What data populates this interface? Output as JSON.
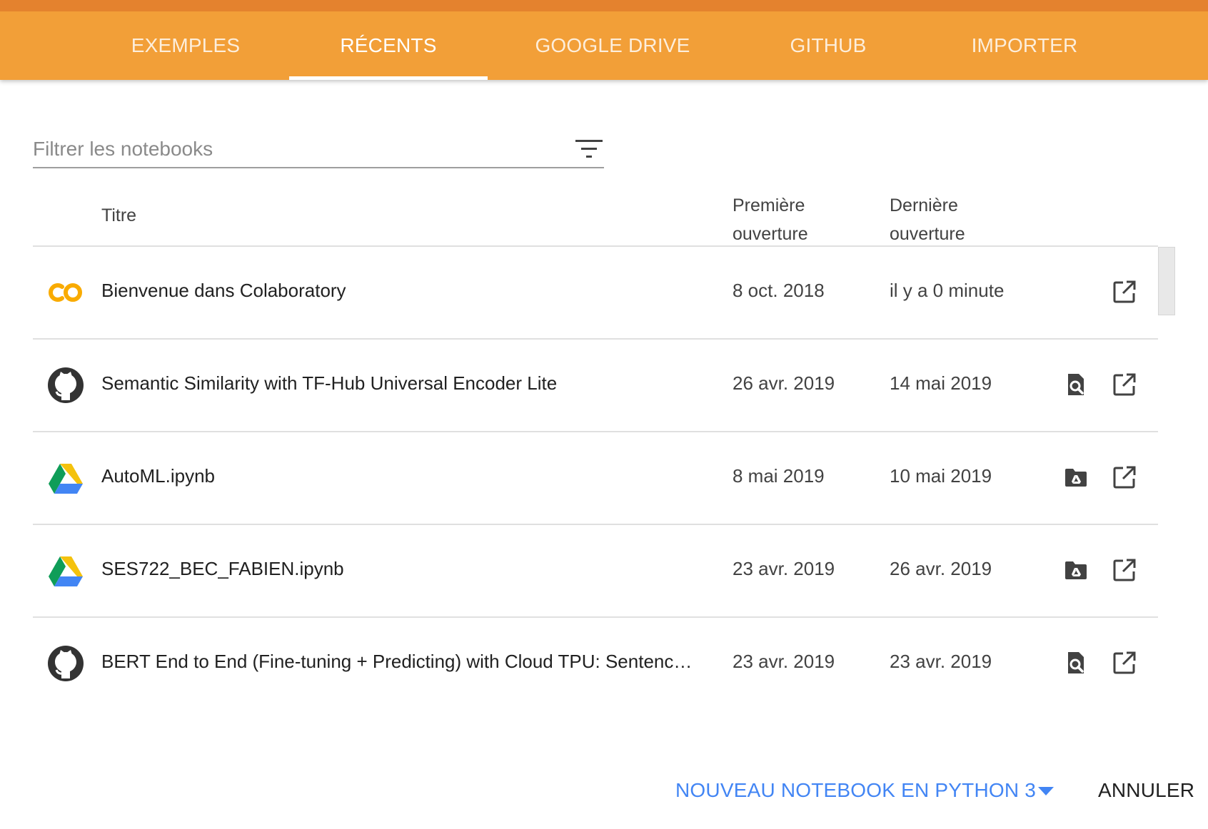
{
  "tabs": [
    {
      "label": "EXEMPLES"
    },
    {
      "label": "RÉCENTS"
    },
    {
      "label": "GOOGLE DRIVE"
    },
    {
      "label": "GITHUB"
    },
    {
      "label": "IMPORTER"
    }
  ],
  "active_tab": "RÉCENTS",
  "filter": {
    "placeholder": "Filtrer les notebooks",
    "value": ""
  },
  "table": {
    "headers": {
      "title": "Titre",
      "first_open_line1": "Première",
      "first_open_line2": "ouverture",
      "last_open_line1": "Dernière",
      "last_open_line2": "ouverture"
    },
    "rows": [
      {
        "source_icon": "colab-icon",
        "title": "Bienvenue dans Colaboratory",
        "first_opened": "8 oct. 2018",
        "last_opened": "il y a 0 minute",
        "action_icon": "",
        "open_icon": "open-in-new-icon"
      },
      {
        "source_icon": "github-icon",
        "title": "Semantic Similarity with TF-Hub Universal Encoder Lite",
        "first_opened": "26 avr. 2019",
        "last_opened": "14 mai 2019",
        "action_icon": "view-on-github-icon",
        "open_icon": "open-in-new-icon"
      },
      {
        "source_icon": "google-drive-icon",
        "title": "AutoML.ipynb",
        "first_opened": "8 mai 2019",
        "last_opened": "10 mai 2019",
        "action_icon": "drive-folder-icon",
        "open_icon": "open-in-new-icon"
      },
      {
        "source_icon": "google-drive-icon",
        "title": "SES722_BEC_FABIEN.ipynb",
        "first_opened": "23 avr. 2019",
        "last_opened": "26 avr. 2019",
        "action_icon": "drive-folder-icon",
        "open_icon": "open-in-new-icon"
      },
      {
        "source_icon": "github-icon",
        "title": "BERT End to End (Fine-tuning + Predicting) with Cloud TPU: Sentence a...",
        "first_opened": "23 avr. 2019",
        "last_opened": "23 avr. 2019",
        "action_icon": "view-on-github-icon",
        "open_icon": "open-in-new-icon"
      }
    ]
  },
  "footer": {
    "new_notebook_label": "NOUVEAU NOTEBOOK EN PYTHON 3",
    "cancel_label": "ANNULER"
  },
  "colors": {
    "tabbar": "#f29f38",
    "tabbar_top": "#e4822e",
    "accent_blue": "#4285f4",
    "colab_orange": "#f9ab00"
  }
}
